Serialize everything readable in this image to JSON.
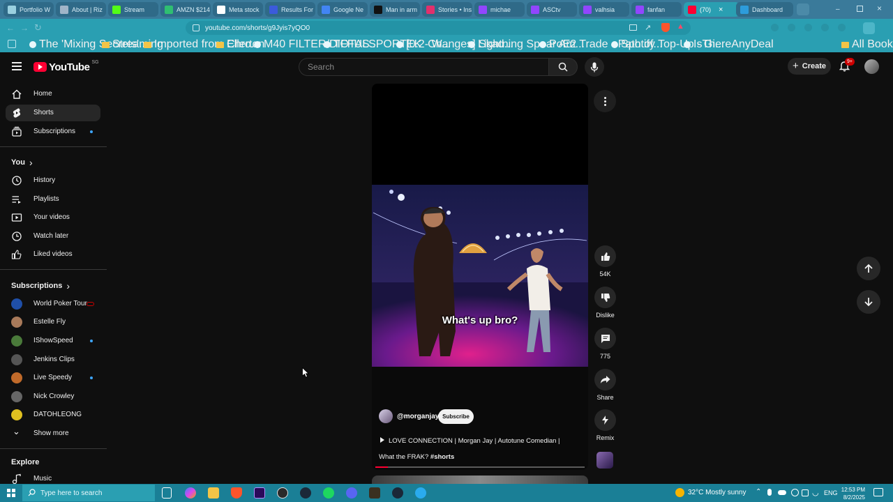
{
  "browser": {
    "tabs": [
      {
        "label": "Portfolio W",
        "color": "#9ad0e0"
      },
      {
        "label": "About | Riz",
        "color": "#a0b4c8"
      },
      {
        "label": "Stream",
        "color": "#53fc18"
      },
      {
        "label": "AMZN $214",
        "color": "#2fbf71"
      },
      {
        "label": "Meta stock",
        "color": "#ffffff"
      },
      {
        "label": "Results For",
        "color": "#3b5bdb"
      },
      {
        "label": "Google Ne",
        "color": "#4285f4"
      },
      {
        "label": "Man in arm",
        "color": "#111111"
      },
      {
        "label": "Stories • Ins",
        "color": "#e1306c"
      },
      {
        "label": "michae",
        "color": "#9146ff"
      },
      {
        "label": "ASCtv",
        "color": "#9146ff"
      },
      {
        "label": "valhsia",
        "color": "#9146ff"
      },
      {
        "label": "fanfan",
        "color": "#9146ff"
      },
      {
        "label": "(70)",
        "color": "#ff0033"
      },
      {
        "label": "Dashboard",
        "color": "#2d9cdb"
      }
    ],
    "url": "youtube.com/shorts/g9Jyis7yQO0",
    "bookmarks": [
      {
        "label": "The 'Mixing Secrets'...",
        "type": "site"
      },
      {
        "label": "Streaming",
        "type": "folder"
      },
      {
        "label": "Imported from Chro...",
        "type": "folder"
      },
      {
        "label": "Ellerton",
        "type": "folder"
      },
      {
        "label": "M40 FILTER/DIFFUS...",
        "type": "site"
      },
      {
        "label": "TOTALSPORTEK - W...",
        "type": "site"
      },
      {
        "label": "[0.2 Changes] Skad...",
        "type": "site"
      },
      {
        "label": "Lightning Spear Am...",
        "type": "site"
      },
      {
        "label": "PoE2 Trade - Path of...",
        "type": "site"
      },
      {
        "label": "Spotify Top-Up - Gi...",
        "type": "site"
      },
      {
        "label": "IsThereAnyDeal",
        "type": "site"
      }
    ],
    "all_bookmarks": "All Bookmarks"
  },
  "header": {
    "logo": "YouTube",
    "region": "SG",
    "search_placeholder": "Search",
    "create_label": "Create",
    "notification_badge": "9+"
  },
  "sidebar": {
    "main": [
      {
        "label": "Home",
        "icon": "home-icon"
      },
      {
        "label": "Shorts",
        "icon": "shorts-icon",
        "active": true
      },
      {
        "label": "Subscriptions",
        "icon": "subscriptions-icon"
      }
    ],
    "you_heading": "You",
    "you": [
      {
        "label": "History",
        "icon": "history-icon"
      },
      {
        "label": "Playlists",
        "icon": "playlists-icon"
      },
      {
        "label": "Your videos",
        "icon": "your-videos-icon"
      },
      {
        "label": "Watch later",
        "icon": "watch-later-icon"
      },
      {
        "label": "Liked videos",
        "icon": "liked-videos-icon"
      }
    ],
    "subscriptions_heading": "Subscriptions",
    "subscriptions": [
      {
        "label": "World Poker Tour",
        "color": "#1f4fa8",
        "live": true
      },
      {
        "label": "Estelle Fly",
        "color": "#a87a5a"
      },
      {
        "label": "IShowSpeed",
        "color": "#4a7a3a",
        "dot": true
      },
      {
        "label": "Jenkins Clips",
        "color": "#555555"
      },
      {
        "label": "Live Speedy",
        "color": "#c06a2a",
        "dot": true
      },
      {
        "label": "Nick Crowley",
        "color": "#666666"
      },
      {
        "label": "DATOHLEONG",
        "color": "#e0c020"
      }
    ],
    "show_more": "Show more",
    "explore_heading": "Explore",
    "explore": [
      {
        "label": "Music",
        "icon": "music-icon"
      }
    ]
  },
  "short": {
    "caption": "What's up bro?",
    "channel": "@morganjay",
    "subscribe_label": "Subscribe",
    "title_line1": "LOVE CONNECTION | Morgan Jay | Autotune Comedian |",
    "title_line2": "What the FRAK?",
    "hashtag": "#shorts",
    "progress": 0.06
  },
  "actions": {
    "likes": "54K",
    "dislike_label": "Dislike",
    "comments": "775",
    "share_label": "Share",
    "remix_label": "Remix"
  },
  "taskbar": {
    "search_placeholder": "Type here to search",
    "weather": "32°C  Mostly sunny",
    "language": "ENG",
    "time": "12:53 PM",
    "date": "8/2/2025"
  }
}
